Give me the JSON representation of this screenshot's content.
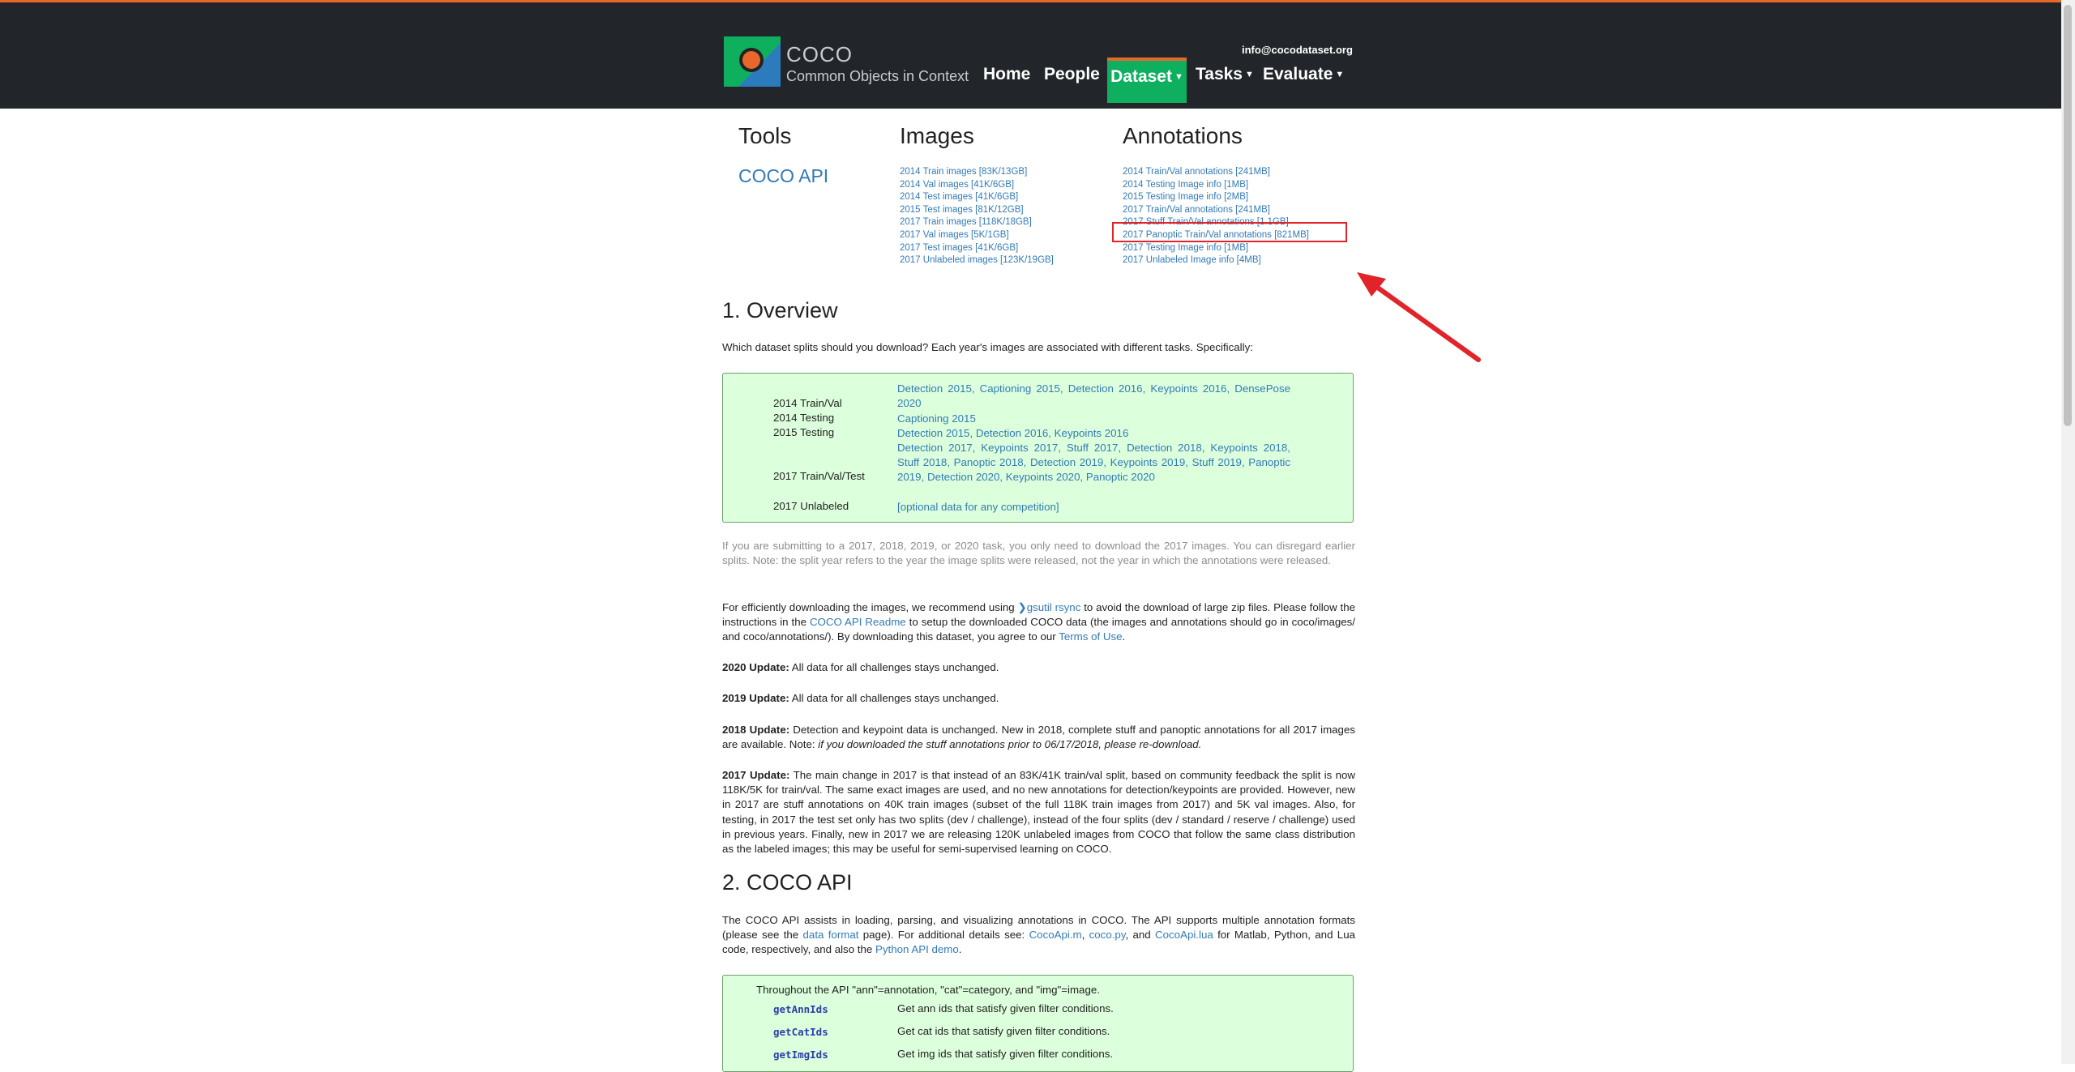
{
  "header": {
    "brand_name": "COCO",
    "brand_tagline": "Common Objects in Context",
    "email": "info@cocodataset.org",
    "nav": [
      "Home",
      "People",
      "Dataset",
      "Tasks",
      "Evaluate"
    ],
    "active_nav": "Dataset"
  },
  "downloads": {
    "tools_title": "Tools",
    "tools_link": "COCO API",
    "images_title": "Images",
    "images": [
      "2014 Train images [83K/13GB]",
      "2014 Val images [41K/6GB]",
      "2014 Test images [41K/6GB]",
      "2015 Test images [81K/12GB]",
      "2017 Train images [118K/18GB]",
      "2017 Val images [5K/1GB]",
      "2017 Test images [41K/6GB]",
      "2017 Unlabeled images [123K/19GB]"
    ],
    "annotations_title": "Annotations",
    "annotations": [
      "2014 Train/Val annotations [241MB]",
      "2014 Testing Image info [1MB]",
      "2015 Testing Image info [2MB]",
      "2017 Train/Val annotations [241MB]",
      "2017 Stuff Train/Val annotations [1.1GB]",
      "2017 Panoptic Train/Val annotations [821MB]",
      "2017 Testing Image info [1MB]",
      "2017 Unlabeled Image info [4MB]"
    ],
    "highlight_color": "#e0242a"
  },
  "overview": {
    "heading": "1. Overview",
    "intro": "Which dataset splits should you download? Each year's images are associated with different tasks. Specifically:",
    "splits": [
      {
        "label": "2014 Train/Val",
        "tasks": "Detection 2015, Captioning 2015, Detection 2016, Keypoints 2016, DensePose 2020"
      },
      {
        "label": "2014 Testing",
        "tasks": "Captioning 2015"
      },
      {
        "label": "2015 Testing",
        "tasks": "Detection 2015, Detection 2016, Keypoints 2016"
      },
      {
        "label": "2017 Train/Val/Test",
        "tasks": "Detection 2017, Keypoints 2017, Stuff 2017, Detection 2018, Keypoints 2018, Stuff 2018, Panoptic 2018, Detection 2019, Keypoints 2019, Stuff 2019, Panoptic 2019, Detection 2020, Keypoints 2020, Panoptic 2020"
      },
      {
        "label": "2017 Unlabeled",
        "tasks": "[optional data for any competition]"
      }
    ],
    "note": "If you are submitting to a 2017, 2018, 2019, or 2020 task, you only need to download the 2017 images. You can disregard earlier splits. Note: the split year refers to the year the image splits were released, not the year in which the annotations were released.",
    "download_p": {
      "t1": "For efficiently downloading the images, we recommend using ",
      "gsutil_link": "gsutil rsync",
      "t2": " to avoid the download of large zip files. Please follow the instructions in the ",
      "readme_link": "COCO API Readme",
      "t3": " to setup the downloaded COCO data (the images and annotations should go in coco/images/ and coco/annotations/). By downloading this dataset, you agree to our ",
      "terms_link": "Terms of Use",
      "t4": "."
    },
    "update_2020": {
      "label": "2020 Update:",
      "text": " All data for all challenges stays unchanged."
    },
    "update_2019": {
      "label": "2019 Update:",
      "text": " All data for all challenges stays unchanged."
    },
    "update_2018": {
      "label": "2018 Update:",
      "text": " Detection and keypoint data is unchanged. New in 2018, complete stuff and panoptic annotations for all 2017 images are available. Note: ",
      "italic": "if you downloaded the stuff annotations prior to 06/17/2018, please re-download."
    },
    "update_2017": {
      "label": "2017 Update:",
      "text": " The main change in 2017 is that instead of an 83K/41K train/val split, based on community feedback the split is now 118K/5K for train/val. The same exact images are used, and no new annotations for detection/keypoints are provided. However, new in 2017 are stuff annotations on 40K train images (subset of the full 118K train images from 2017) and 5K val images. Also, for testing, in 2017 the test set only has two splits (dev / challenge), instead of the four splits (dev / standard / reserve / challenge) used in previous years. Finally, new in 2017 we are releasing 120K unlabeled images from COCO that follow the same class distribution as the labeled images; this may be useful for semi-supervised learning on COCO."
    }
  },
  "api": {
    "heading": "2. COCO API",
    "p": {
      "t1": "The COCO API assists in loading, parsing, and visualizing annotations in COCO. The API supports multiple annotation formats (please see the ",
      "format_link": "data format",
      "t2": " page). For additional details see: ",
      "m_link": "CocoApi.m",
      "t3": ", ",
      "py_link": "coco.py",
      "t4": ", and ",
      "lua_link": "CocoApi.lua",
      "t5": " for Matlab, Python, and Lua code, respectively, and also the ",
      "demo_link": "Python API demo",
      "t6": "."
    },
    "box_intro": "Throughout the API \"ann\"=annotation, \"cat\"=category, and \"img\"=image.",
    "functions": [
      {
        "name": "getAnnIds",
        "desc": "Get ann ids that satisfy given filter conditions."
      },
      {
        "name": "getCatIds",
        "desc": "Get cat ids that satisfy given filter conditions."
      },
      {
        "name": "getImgIds",
        "desc": "Get img ids that satisfy given filter conditions."
      }
    ]
  }
}
